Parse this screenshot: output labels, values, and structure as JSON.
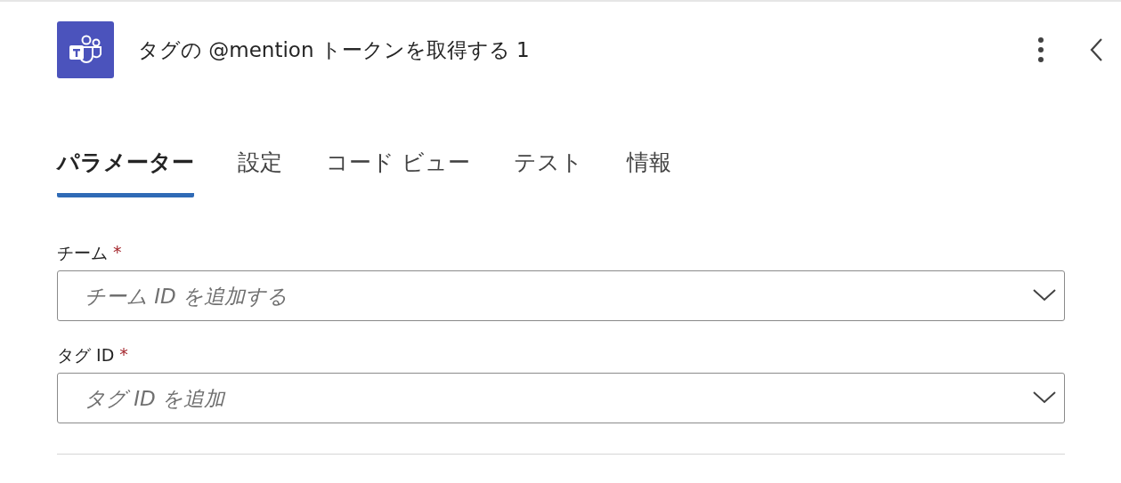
{
  "header": {
    "title": "タグの @mention トークンを取得する 1"
  },
  "tabs": [
    {
      "label": "パラメーター",
      "selected": true
    },
    {
      "label": "設定",
      "selected": false
    },
    {
      "label": "コード ビュー",
      "selected": false
    },
    {
      "label": "テスト",
      "selected": false
    },
    {
      "label": "情報",
      "selected": false
    }
  ],
  "fields": [
    {
      "label": "チーム",
      "required_mark": "*",
      "placeholder": "チーム ID を追加する"
    },
    {
      "label": "タグ ID",
      "required_mark": "*",
      "placeholder": "タグ ID を追加"
    }
  ]
}
